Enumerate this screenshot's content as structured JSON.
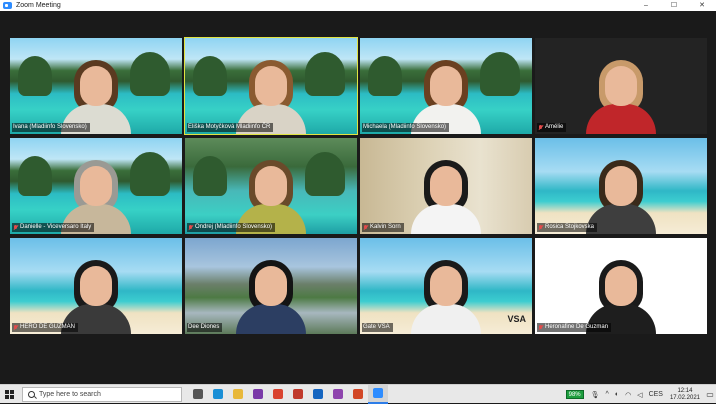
{
  "window": {
    "title": "Zoom Meeting",
    "controls": [
      "–",
      "☐",
      "✕"
    ]
  },
  "participants": [
    {
      "name": "Ivana (Mladiinfo Slovensko)",
      "bg": "lagoon",
      "hair": "#5a3a20",
      "shirt": "#dcdcd2",
      "muted": false
    },
    {
      "name": "Eliška Motyčková Mladiinfo ČR",
      "bg": "lagoon",
      "hair": "#8a5a30",
      "shirt": "#d9d3c6",
      "muted": false,
      "active": true
    },
    {
      "name": "Michaela (Mladiinfo Slovensko)",
      "bg": "lagoon",
      "hair": "#6a4020",
      "shirt": "#f2f2ef",
      "muted": false
    },
    {
      "name": "Amélie",
      "bg": "dark",
      "hair": "#c89a6a",
      "shirt": "#c0262a",
      "muted": true
    },
    {
      "name": "Danielle - Viceversaro Italy",
      "bg": "lagoon",
      "hair": "#9a9a94",
      "shirt": "#c7b79b",
      "muted": true
    },
    {
      "name": "Ondrej (Mladiinfo Slovensko)",
      "bg": "lagoon2",
      "hair": "#6a4a2a",
      "shirt": "#b4b24a",
      "muted": true
    },
    {
      "name": "Kalvin Sorn",
      "bg": "office",
      "hair": "#1a1a1a",
      "shirt": "#f4f4f4",
      "muted": true
    },
    {
      "name": "Rosica Stojkovska",
      "bg": "beach",
      "hair": "#3a2a1a",
      "shirt": "#3e3e3e",
      "muted": true
    },
    {
      "name": "HERO DE GUZMAN",
      "bg": "beach",
      "hair": "#1a1a1a",
      "shirt": "#3a3a3a",
      "muted": true
    },
    {
      "name": "Dee Diones",
      "bg": "mountain",
      "hair": "#141414",
      "shirt": "#2c3e62",
      "muted": false
    },
    {
      "name": "Gate VSA",
      "bg": "beach",
      "hair": "#1a1a1a",
      "shirt": "#f0f0f0",
      "muted": false,
      "logo": "VSA"
    },
    {
      "name": "Heronafine De Guzman",
      "bg": "white",
      "hair": "#1a1a1a",
      "shirt": "#1e1e1e",
      "muted": true
    }
  ],
  "taskbar": {
    "search_placeholder": "Type here to search",
    "apps": [
      {
        "name": "task-view",
        "color": "#555555"
      },
      {
        "name": "edge",
        "color": "#1a8fd6"
      },
      {
        "name": "file-explorer",
        "color": "#e8b83a"
      },
      {
        "name": "onenote",
        "color": "#7b3aa8"
      },
      {
        "name": "chrome",
        "color": "#d9432f"
      },
      {
        "name": "acrobat",
        "color": "#c0392b"
      },
      {
        "name": "outlook",
        "color": "#1565c0"
      },
      {
        "name": "onenote-2",
        "color": "#8e44ad"
      },
      {
        "name": "powerpoint",
        "color": "#d24726"
      },
      {
        "name": "zoom",
        "color": "#2d8cff",
        "active": true
      }
    ],
    "battery": "98%",
    "language": "CES",
    "time": "12:14",
    "date": "17.02.2021"
  }
}
